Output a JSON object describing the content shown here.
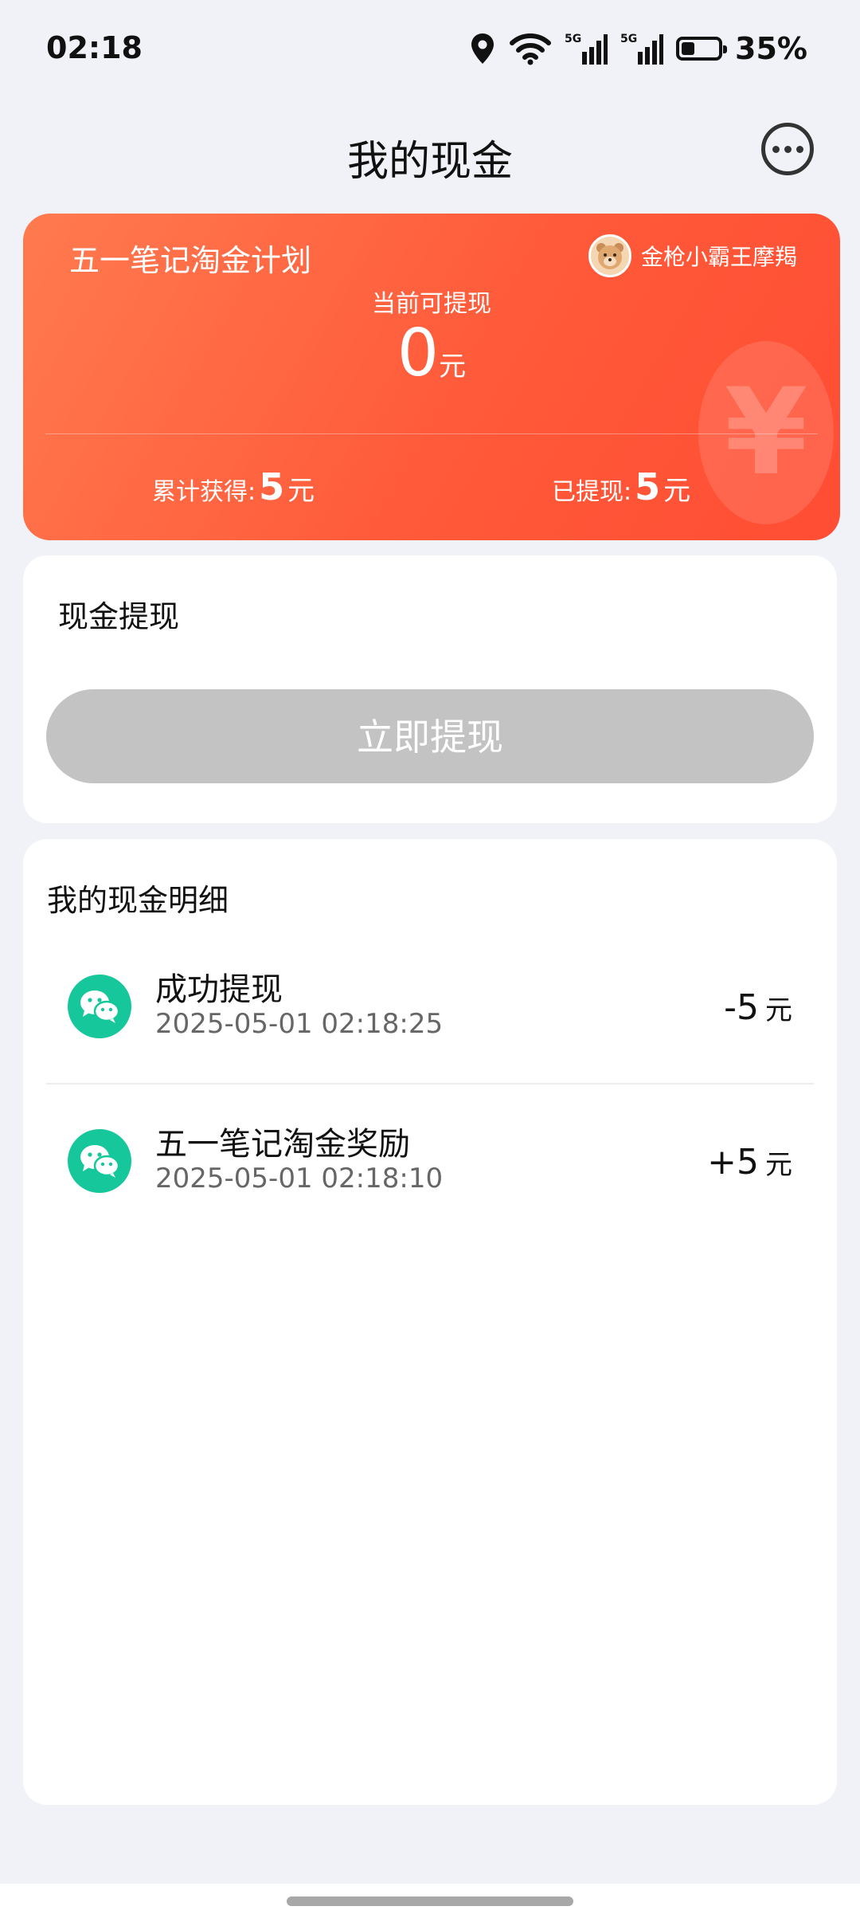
{
  "status_bar": {
    "time": "02:18",
    "battery": "35%",
    "icons": [
      "location-icon",
      "wifi-icon",
      "5g-signal-icon",
      "5g-signal-icon",
      "battery-icon"
    ]
  },
  "header": {
    "title": "我的现金",
    "more_icon": "more-icon"
  },
  "cash_card": {
    "campaign": "五一笔记淘金计划",
    "owner_name": "金枪小霸王摩羯",
    "available_label": "当前可提现",
    "available_amount": "0",
    "unit": "元",
    "total_earned_label": "累计获得:",
    "total_earned": "5",
    "withdrawn_label": "已提现:",
    "withdrawn": "5",
    "coin_symbol": "¥"
  },
  "withdraw": {
    "title": "现金提现",
    "button_label": "立即提现"
  },
  "details": {
    "title": "我的现金明细",
    "transactions": [
      {
        "title": "成功提现",
        "time": "2025-05-01 02:18:25",
        "amount": "-5",
        "unit": "元",
        "icon": "wechat-icon"
      },
      {
        "title": "五一笔记淘金奖励",
        "time": "2025-05-01 02:18:10",
        "amount": "+5",
        "unit": "元",
        "icon": "wechat-icon"
      }
    ]
  },
  "colors": {
    "card_start": "#ff7a4f",
    "card_end": "#ff4d33",
    "wechat_green": "#15c79a",
    "disabled_button": "#c3c3c3",
    "page_bg": "#f1f2f8"
  }
}
